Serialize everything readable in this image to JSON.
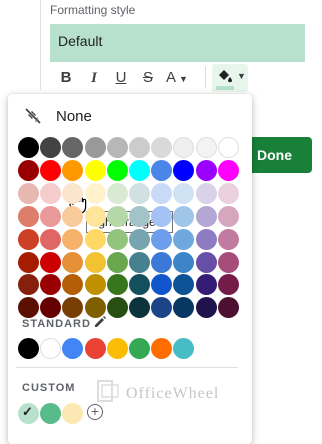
{
  "formatting": {
    "label": "Formatting style",
    "style_value": "Default",
    "toolbar": {
      "bold": "B",
      "italic": "I",
      "underline": "U",
      "strikethrough": "S",
      "text_color": "A",
      "fill_icon": "paint-bucket-icon",
      "fill_color": "#b7e1cd"
    }
  },
  "done_label": "Done",
  "done_color": "#188038",
  "palette": {
    "none_label": "None",
    "standard_label": "STANDARD",
    "custom_label": "CUSTOM",
    "tooltip": "light orange 3",
    "grid": [
      [
        "#000000",
        "#434343",
        "#666666",
        "#999999",
        "#b7b7b7",
        "#cccccc",
        "#d9d9d9",
        "#efefef",
        "#f3f3f3",
        "#ffffff"
      ],
      [
        "#980000",
        "#ff0000",
        "#ff9900",
        "#ffff00",
        "#00ff00",
        "#00ffff",
        "#4a86e8",
        "#0000ff",
        "#9900ff",
        "#ff00ff"
      ],
      [
        "#e6b8af",
        "#f4cccc",
        "#fce5cd",
        "#fff2cc",
        "#d9ead3",
        "#d0e0e3",
        "#c9daf8",
        "#cfe2f3",
        "#d9d2e9",
        "#ead1dc"
      ],
      [
        "#dd7e6b",
        "#ea9999",
        "#f9cb9c",
        "#ffe599",
        "#b6d7a8",
        "#a2c4c9",
        "#a4c2f4",
        "#9fc5e8",
        "#b4a7d6",
        "#d5a6bd"
      ],
      [
        "#cc4125",
        "#e06666",
        "#f6b26b",
        "#ffd966",
        "#93c47d",
        "#76a5af",
        "#6d9eeb",
        "#6fa8dc",
        "#8e7cc3",
        "#c27ba0"
      ],
      [
        "#a61c00",
        "#cc0000",
        "#e69138",
        "#f1c232",
        "#6aa84f",
        "#45818e",
        "#3c78d8",
        "#3d85c6",
        "#674ea7",
        "#a64d79"
      ],
      [
        "#85200c",
        "#990000",
        "#b45f06",
        "#bf9000",
        "#38761d",
        "#134f5c",
        "#1155cc",
        "#0b5394",
        "#351c75",
        "#741b47"
      ],
      [
        "#5b0f00",
        "#660000",
        "#783f04",
        "#7f6000",
        "#274e13",
        "#0c343d",
        "#1c4587",
        "#073763",
        "#20124d",
        "#4c1130"
      ]
    ],
    "standard": [
      "#000000",
      "#ffffff",
      "#4285f4",
      "#ea4335",
      "#fbbc04",
      "#34a853",
      "#ff6d01",
      "#46bdc6"
    ],
    "custom": [
      "#b7e1cd",
      "#57bb8a",
      "#fce8b2"
    ]
  },
  "watermark_text": "OfficeWheel"
}
